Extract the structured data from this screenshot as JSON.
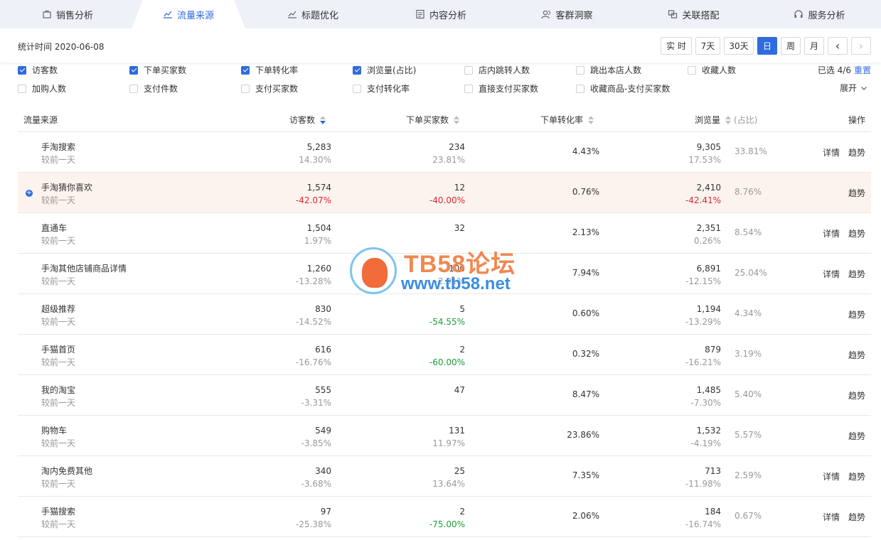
{
  "tabs": [
    {
      "label": "销售分析",
      "icon": "bag-icon"
    },
    {
      "label": "流量来源",
      "icon": "trend-icon",
      "active": true
    },
    {
      "label": "标题优化",
      "icon": "trend-icon"
    },
    {
      "label": "内容分析",
      "icon": "document-icon"
    },
    {
      "label": "客群洞察",
      "icon": "users-icon"
    },
    {
      "label": "关联搭配",
      "icon": "link-icon"
    },
    {
      "label": "服务分析",
      "icon": "headset-icon"
    }
  ],
  "stat": {
    "label": "统计时间 2020-06-08",
    "buttons": [
      "实 时",
      "7天",
      "30天",
      "日",
      "周",
      "月"
    ],
    "active": "日",
    "prev": "‹",
    "next": "›"
  },
  "filters": {
    "items": [
      {
        "label": "访客数",
        "checked": true
      },
      {
        "label": "下单买家数",
        "checked": true
      },
      {
        "label": "下单转化率",
        "checked": true
      },
      {
        "label": "浏览量(占比)",
        "checked": true
      },
      {
        "label": "店内跳转人数",
        "checked": false
      },
      {
        "label": "跳出本店人数",
        "checked": false
      },
      {
        "label": "收藏人数",
        "checked": false
      },
      {
        "label": "加购人数",
        "checked": false
      },
      {
        "label": "支付件数",
        "checked": false
      },
      {
        "label": "支付买家数",
        "checked": false
      },
      {
        "label": "支付转化率",
        "checked": false
      },
      {
        "label": "直接支付买家数",
        "checked": false
      },
      {
        "label": "收藏商品-支付买家数",
        "checked": false
      }
    ],
    "selected_text": "已选 4/6",
    "reset": "重置",
    "expand": "展开"
  },
  "table": {
    "headers": {
      "source": "流量来源",
      "visitors": "访客数",
      "buyers": "下单买家数",
      "rate": "下单转化率",
      "pv": "浏览量",
      "pv_share": "(占比)",
      "ops": "操作"
    },
    "compare_label": "较前一天",
    "ops_detail": "详情",
    "ops_trend": "趋势",
    "rows": [
      {
        "name": "手淘搜索",
        "visitors": "5,283",
        "visitors_chg": "14.30%",
        "buyers": "234",
        "buyers_chg": "23.81%",
        "rate": "4.43%",
        "pv": "9,305",
        "pv_chg": "17.53%",
        "share": "33.81%",
        "detail": true
      },
      {
        "name": "手淘猜你喜欢",
        "visitors": "1,574",
        "visitors_chg": "-42.07%",
        "buyers": "12",
        "buyers_chg": "-40.00%",
        "rate": "0.76%",
        "pv": "2,410",
        "pv_chg": "-42.41%",
        "share": "8.76%",
        "detail": false,
        "highlight": true
      },
      {
        "name": "直通车",
        "visitors": "1,504",
        "visitors_chg": "1.97%",
        "buyers": "32",
        "buyers_chg": "",
        "rate": "2.13%",
        "pv": "2,351",
        "pv_chg": "0.26%",
        "share": "8.54%",
        "detail": true
      },
      {
        "name": "手淘其他店铺商品详情",
        "visitors": "1,260",
        "visitors_chg": "-13.28%",
        "buyers": "100",
        "buyers_chg": "-2.91%",
        "rate": "7.94%",
        "pv": "6,891",
        "pv_chg": "-12.15%",
        "share": "25.04%",
        "detail": true
      },
      {
        "name": "超级推荐",
        "visitors": "830",
        "visitors_chg": "-14.52%",
        "buyers": "5",
        "buyers_chg": "-54.55%",
        "rate": "0.60%",
        "pv": "1,194",
        "pv_chg": "-13.29%",
        "share": "4.34%",
        "detail": false
      },
      {
        "name": "手猫首页",
        "visitors": "616",
        "visitors_chg": "-16.76%",
        "buyers": "2",
        "buyers_chg": "-60.00%",
        "rate": "0.32%",
        "pv": "879",
        "pv_chg": "-16.21%",
        "share": "3.19%",
        "detail": false
      },
      {
        "name": "我的淘宝",
        "visitors": "555",
        "visitors_chg": "-3.31%",
        "buyers": "47",
        "buyers_chg": "",
        "rate": "8.47%",
        "pv": "1,485",
        "pv_chg": "-7.30%",
        "share": "5.40%",
        "detail": false
      },
      {
        "name": "购物车",
        "visitors": "549",
        "visitors_chg": "-3.85%",
        "buyers": "131",
        "buyers_chg": "11.97%",
        "rate": "23.86%",
        "pv": "1,532",
        "pv_chg": "-4.19%",
        "share": "5.57%",
        "detail": false
      },
      {
        "name": "淘内免费其他",
        "visitors": "340",
        "visitors_chg": "-3.68%",
        "buyers": "25",
        "buyers_chg": "13.64%",
        "rate": "7.35%",
        "pv": "713",
        "pv_chg": "-11.98%",
        "share": "2.59%",
        "detail": true
      },
      {
        "name": "手猫搜索",
        "visitors": "97",
        "visitors_chg": "-25.38%",
        "buyers": "2",
        "buyers_chg": "-75.00%",
        "rate": "2.06%",
        "pv": "184",
        "pv_chg": "-16.74%",
        "share": "0.67%",
        "detail": true
      }
    ]
  },
  "watermark": {
    "title": "TB58论坛",
    "url": "www.tb58.net"
  },
  "colors": {
    "accent": "#2f6bde",
    "negative": "#e0262f",
    "positive": "#1a9e34",
    "highlight_row": "#fdf3ee"
  }
}
